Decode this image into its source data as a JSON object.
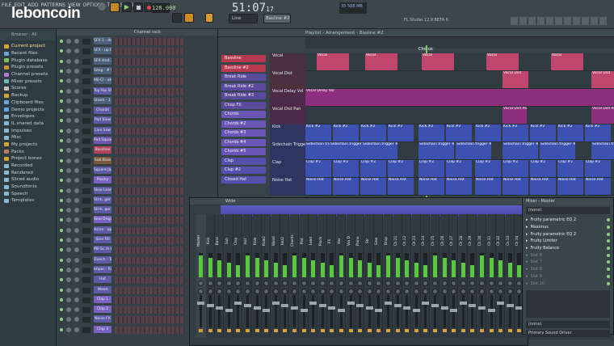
{
  "menu": [
    "FILE",
    "EDIT",
    "ADD",
    "PATTERNS",
    "VIEW",
    "OPTIONS",
    "TOOLS",
    "HELP"
  ],
  "watermark": "leboncoin",
  "transport": {
    "tempo": "128.000",
    "time": "51:07",
    "time_sub": "17",
    "pattern": "Basline #2",
    "snap": "Line",
    "version": "FL Studio 12.9 BETA 6",
    "cpu": "35",
    "mem": "588 MB"
  },
  "browser": {
    "title": "Browser - All",
    "items": [
      "Current project",
      "Recent files",
      "Plugin database",
      "Plugin presets",
      "Channel presets",
      "Mixer presets",
      "Scores",
      "Backup",
      "Clipboard files",
      "Demo projects",
      "Envelopes",
      "IL shared data",
      "Impulses",
      "Misc",
      "My projects",
      "Packs",
      "Project bones",
      "Recorded",
      "Rendered",
      "Sliced audio",
      "Soundfonts",
      "Speech",
      "Templates"
    ]
  },
  "channel_rack": {
    "title": "Channel rack",
    "channels": [
      "SFX 1 - delay",
      "SFX - up RC",
      "SFX shot 2",
      "Smig - # SFX",
      "Mil-Cl - aten",
      "Toy Rip SFX",
      "Strom - 1 SFX",
      "Chords",
      "Pad Slow",
      "Live Saw",
      "Pad Square",
      "Bassline",
      "Sub Bass",
      "Square Jack",
      "Plucky",
      "Slow Lead",
      "Strin. ger 1",
      "Strin. ger 2",
      "Sine Drop",
      "Asine - op FX",
      "Sine Fill",
      "Mil-Sc re FX",
      "Dunch - Tom",
      "Impor - Ride",
      "Hat",
      "Wood",
      "Clap 1",
      "Clap 2",
      "Noise FX",
      "Clap 3"
    ]
  },
  "playlist": {
    "title": "Playlist - Arrangement - Basline #2",
    "marker": "Chorus",
    "patterns": [
      "Bassline",
      "Bassline #2",
      "Break Ride",
      "Break Ride #2",
      "Break Ride #3",
      "Chop FX",
      "Chords",
      "Chords #2",
      "Chords #3",
      "Chords #4",
      "Chords #5",
      "Clap",
      "Clap #2",
      "Closed Hat"
    ],
    "tracks": [
      "Vocal",
      "Vocal Dist",
      "Vocal Delay Vol",
      "Vocal Dist Pan",
      "Kick",
      "Sidechain Trigger",
      "Clap",
      "Noise Hat"
    ],
    "clips": {
      "vocal": "Vocal",
      "vdist": "Vocal Dist",
      "vdelay": "Vocal Delay Vol",
      "vpan": "Vocal Dist Pan",
      "kick": "Kick #2",
      "side": "Sidechain trigger #2",
      "clap": "Clap #2",
      "nhat": "Noise Hat",
      "last": "Sidechain trigger #2"
    }
  },
  "mixer": {
    "title": "Wide",
    "strips": [
      "Master",
      "Kick",
      "Bass",
      "Sub",
      "Clap",
      "Hat",
      "Ride",
      "Ride2",
      "Wood",
      "Hat2",
      "Chords",
      "Pad",
      "Lead",
      "Pluck",
      "FX",
      "Vox",
      "Vox D",
      "Piano",
      "Str",
      "Sine",
      "Drop",
      "Ch 21",
      "Ch 22",
      "Ch 23",
      "Ch 24",
      "Ch 25",
      "Ch 26",
      "Ch 27",
      "Ch 28",
      "Ch 29",
      "Ch 30",
      "Ch 31",
      "Ch 32",
      "Ch 33",
      "Ch 34"
    ]
  },
  "mixer_side": {
    "title": "Mixer - Master",
    "preset": "(none)",
    "inserts": [
      "Fruity parametric EQ 2",
      "Maximus",
      "Fruity parametric EQ 2",
      "Fruity Limiter",
      "Fruity Balance",
      "Slot 6",
      "Slot 7",
      "Slot 8",
      "Slot 9",
      "Slot 10"
    ],
    "out_none": "(none)",
    "out_driver": "Primary Sound Driver"
  },
  "colors": {
    "pink": "#c0466e",
    "purple": "#6a3f8a",
    "blue": "#3d52b0",
    "magenta": "#8d2f7d"
  }
}
